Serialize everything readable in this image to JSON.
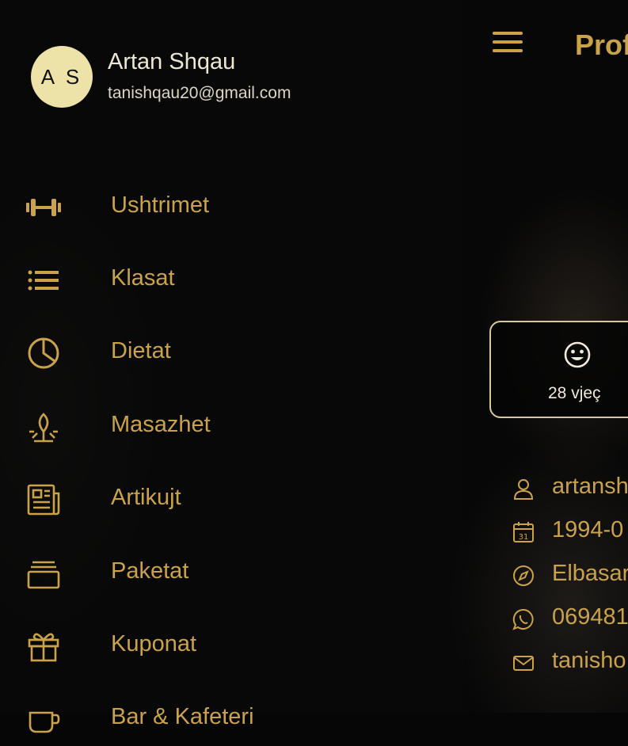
{
  "drawer": {
    "avatar_initials": "A S",
    "user_name": "Artan Shqau",
    "user_email": "tanishqau20@gmail.com",
    "items": [
      {
        "label": "Ushtrimet",
        "icon": "dumbbell-icon"
      },
      {
        "label": "Klasat",
        "icon": "list-icon"
      },
      {
        "label": "Dietat",
        "icon": "pie-chart-icon"
      },
      {
        "label": "Masazhet",
        "icon": "spa-icon"
      },
      {
        "label": "Artikujt",
        "icon": "newspaper-icon"
      },
      {
        "label": "Paketat",
        "icon": "package-icon"
      },
      {
        "label": "Kuponat",
        "icon": "gift-icon"
      },
      {
        "label": "Bar & Kafeteri",
        "icon": "cafe-icon"
      }
    ]
  },
  "profile": {
    "title": "Prof",
    "age_text": "28 vjeç",
    "info": [
      {
        "text": "artansh",
        "icon": "user-icon"
      },
      {
        "text": "1994-0",
        "icon": "calendar-icon"
      },
      {
        "text": "Elbasar",
        "icon": "compass-icon"
      },
      {
        "text": "069481",
        "icon": "whatsapp-icon"
      },
      {
        "text": "tanisho",
        "icon": "mail-icon"
      }
    ]
  },
  "colors": {
    "accent": "#c9a24a",
    "avatar_bg": "#ede2a8",
    "background": "#060606"
  }
}
